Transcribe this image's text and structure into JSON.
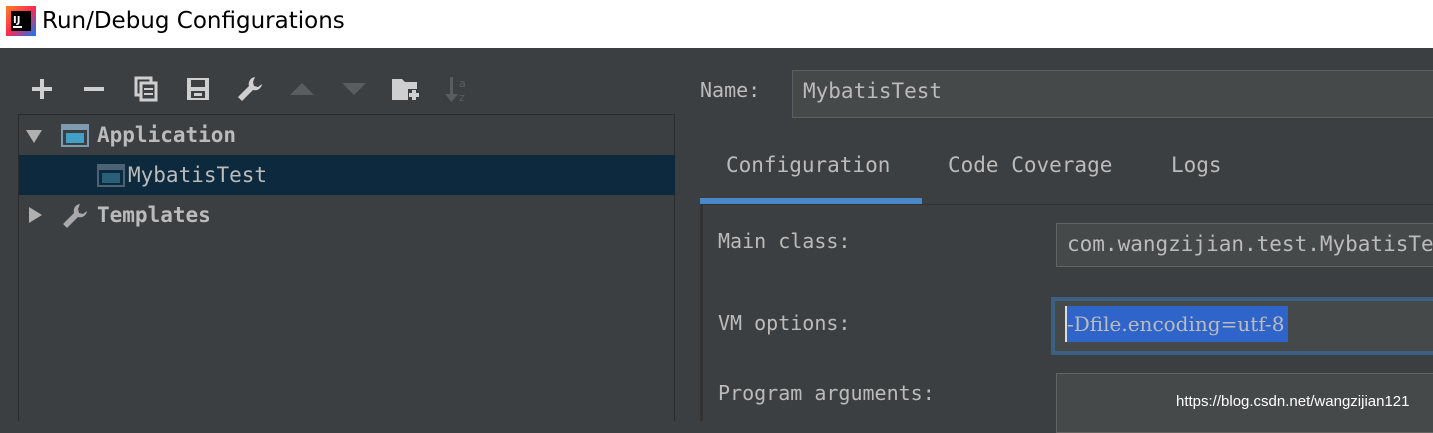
{
  "window": {
    "title": "Run/Debug Configurations"
  },
  "icons": {
    "app": "intellij-idea-icon",
    "add": "plus-icon",
    "remove": "minus-icon",
    "copy": "copy-icon",
    "save": "save-icon",
    "edit_defaults": "wrench-icon",
    "move_up": "arrow-up-icon",
    "move_down": "arrow-down-icon",
    "new_folder": "new-folder-icon",
    "sort": "sort-az-icon"
  },
  "tree": {
    "items": [
      {
        "label": "Application",
        "expanded": true
      },
      {
        "label": "MybatisTest",
        "selected": true
      },
      {
        "label": "Templates",
        "expanded": false
      }
    ]
  },
  "name_field": {
    "label": "Name:",
    "value": "MybatisTest"
  },
  "tabs": [
    {
      "label": "Configuration",
      "active": true
    },
    {
      "label": "Code Coverage"
    },
    {
      "label": "Logs"
    }
  ],
  "form": {
    "main_class": {
      "label": "Main class:",
      "value": "com.wangzijian.test.MybatisTest"
    },
    "vm_options": {
      "label": "VM options:",
      "value": "-Dfile.encoding=utf-8"
    },
    "program_arguments": {
      "label": "Program arguments:",
      "value": ""
    }
  },
  "watermark": "https://blog.csdn.net/wangzijian121",
  "colors": {
    "background": "#3c3f41",
    "selection": "#0d293e",
    "accent": "#4a88c7",
    "text_selection": "#2f65ca"
  }
}
